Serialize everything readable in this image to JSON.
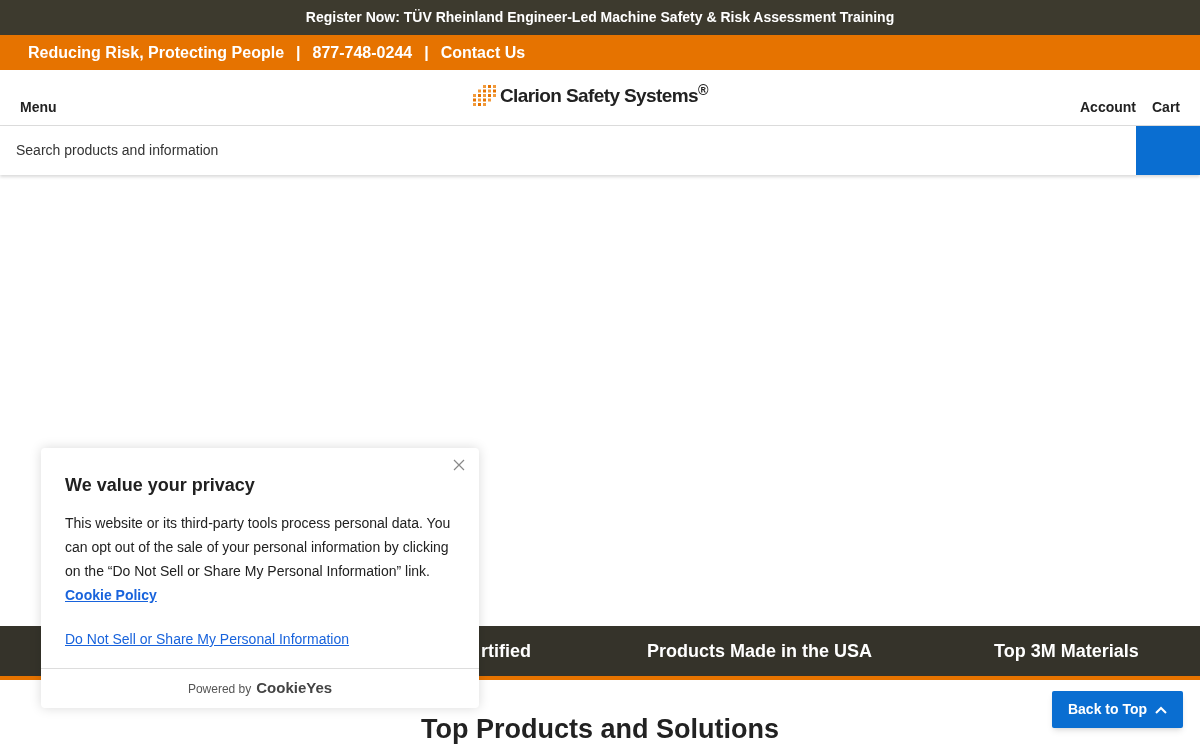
{
  "announcement": "Register Now: TÜV Rheinland Engineer-Led Machine Safety & Risk Assessment Training",
  "info_bar": {
    "items": [
      "Reducing Risk, Protecting People",
      "877-748-0244",
      "Contact Us"
    ],
    "separator": "|"
  },
  "header": {
    "menu": "Menu",
    "logo": "Clarion Safety Systems$^{®}$",
    "links": [
      "Account",
      "Cart"
    ]
  },
  "search": {
    "placeholder": "Search products and information"
  },
  "feature_band": [
    "rtified",
    "Products Made in the USA",
    "Top 3M Materials"
  ],
  "section_title": "Top Products and Solutions",
  "back_to_top": "Back to Top",
  "cookie_banner": {
    "title": "We value your privacy",
    "body": "This website or its third-party tools process personal data. You can opt out of the sale of your personal information by clicking on the “Do Not Sell or Share My Personal Information” link.",
    "policy_link": "Cookie Policy",
    "do_not_sell_link": "Do Not Sell or Share My Personal Information",
    "powered_by": "Powered by",
    "brand": "CookieYes"
  }
}
